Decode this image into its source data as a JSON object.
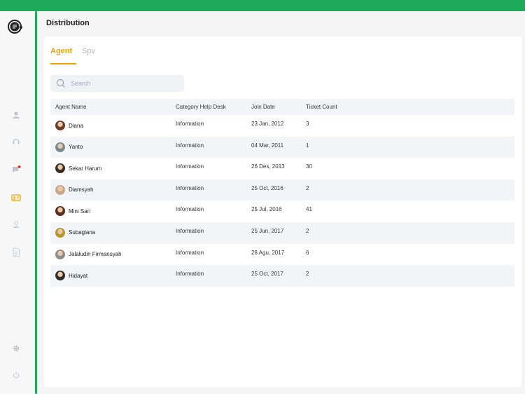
{
  "page_title": "Distribution",
  "tabs": [
    {
      "label": "Agent",
      "active": true
    },
    {
      "label": "Spv",
      "active": false
    }
  ],
  "search": {
    "placeholder": "Search",
    "value": ""
  },
  "table": {
    "headers": [
      "Agent Name",
      "Category Help Desk",
      "Join Date",
      "Ticket Count"
    ],
    "rows": [
      {
        "name": "Diana",
        "category": "Information",
        "join_date": "23 Jan, 2012",
        "ticket_count": "3",
        "avatar_color": "#6b3a2a"
      },
      {
        "name": "Yanto",
        "category": "Information",
        "join_date": "04 Mar, 2011",
        "ticket_count": "1",
        "avatar_color": "#7a8a95"
      },
      {
        "name": "Sekar Harum",
        "category": "Information",
        "join_date": "26 Des, 2013",
        "ticket_count": "30",
        "avatar_color": "#3a2d24"
      },
      {
        "name": "Diamsyah",
        "category": "Information",
        "join_date": "25 Oct, 2016",
        "ticket_count": "2",
        "avatar_color": "#c9a68a"
      },
      {
        "name": "Mini Sari",
        "category": "Information",
        "join_date": "25 Jul, 2016",
        "ticket_count": "41",
        "avatar_color": "#5a2e22"
      },
      {
        "name": "Subagiana",
        "category": "Information",
        "join_date": "25 Jun, 2017",
        "ticket_count": "2",
        "avatar_color": "#b8962e"
      },
      {
        "name": "Jalaludin Firmansyah",
        "category": "Information",
        "join_date": "26 Agu, 2017",
        "ticket_count": "6",
        "avatar_color": "#8d8d8d"
      },
      {
        "name": "Hidayat",
        "category": "Information",
        "join_date": "25 Oct, 2017",
        "ticket_count": "2",
        "avatar_color": "#2d2d2d"
      }
    ]
  },
  "sidebar": {
    "items": [
      {
        "icon": "user-icon"
      },
      {
        "icon": "headset-icon"
      },
      {
        "icon": "chat-icon",
        "badge_color": "#e53935"
      },
      {
        "icon": "id-card-icon",
        "active_color": "#f0a500"
      },
      {
        "icon": "agent-icon"
      },
      {
        "icon": "document-icon"
      },
      {
        "icon": "gear-icon"
      },
      {
        "icon": "power-icon"
      }
    ]
  },
  "colors": {
    "brand": "#1faa59",
    "accent": "#f0a500"
  }
}
